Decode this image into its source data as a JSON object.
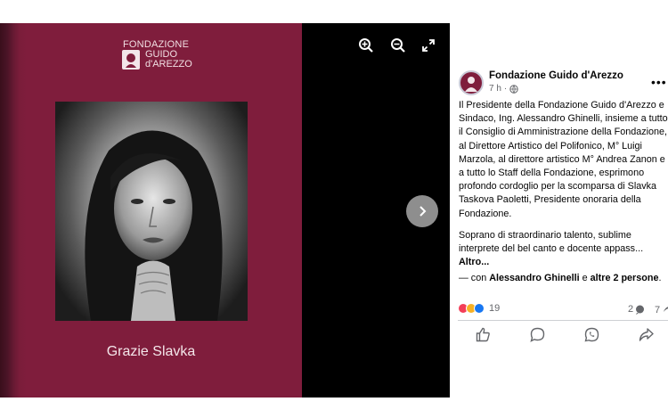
{
  "image": {
    "logo": {
      "line1": "FONDAZIONE",
      "line2": "GUIDO",
      "line3": "d'AREZZO"
    },
    "caption": "Grazie Slavka"
  },
  "viewer_controls": {
    "icons": [
      "zoom-in-icon",
      "zoom-out-icon",
      "fullscreen-icon",
      "chevron-right-icon"
    ]
  },
  "post": {
    "author": "Fondazione Guido d'Arezzo",
    "time": "7 h",
    "separator": "·",
    "paragraph1": "Il Presidente della Fondazione Guido d'Arezzo e\nSindaco, Ing. Alessandro Ghinelli, insieme a tutto\nil Consiglio di Amministrazione della Fondazione,\nal Direttore Artistico del Polifonico, M° Luigi\nMarzola, al direttore artistico M° Andrea Zanon e\na tutto lo Staff della Fondazione, esprimono\nprofondo cordoglio per la scomparsa di Slavka\nTaskova Paoletti, Presidente onoraria della\nFondazione.",
    "paragraph2": "Soprano di straordinario talento, sublime\ninterprete del bel canto e docente appass...",
    "see_more": "Altro...",
    "tag_prefix": "— con",
    "tag_person": "Alessandro Ghinelli",
    "tag_and": "e",
    "tag_others": "altre 2 persone",
    "tag_suffix": ".",
    "reaction_count": "19",
    "comment_count": "2",
    "share_count": "7",
    "colors": {
      "brand": "#7f1d3c",
      "love": "#f33e58",
      "care": "#f7b125",
      "like": "#1877f2"
    }
  }
}
